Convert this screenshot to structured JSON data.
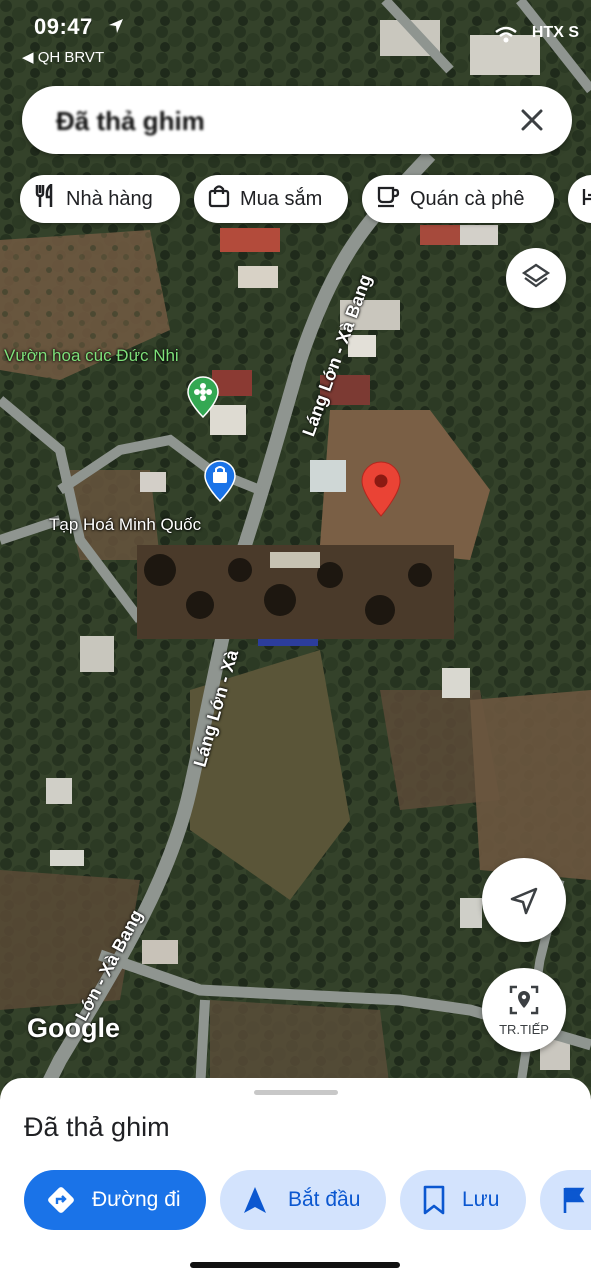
{
  "status_bar": {
    "time": "09:47",
    "back_label": "◀ QH BRVT",
    "carrier": "HTX S"
  },
  "search": {
    "query": "Đã thả ghim"
  },
  "chips": [
    {
      "label": "Nhà hàng",
      "icon": "fork-knife-icon"
    },
    {
      "label": "Mua sắm",
      "icon": "shopping-bag-icon"
    },
    {
      "label": "Quán cà phê",
      "icon": "coffee-cup-icon"
    }
  ],
  "map": {
    "places": [
      {
        "name": "Vườn hoa cúc Đức Nhi",
        "icon": "flower-pin-icon",
        "color": "#34a853"
      },
      {
        "name": "Tạp Hoá Minh Quốc",
        "icon": "shopping-pin-icon",
        "color": "#1a73e8"
      }
    ],
    "roads": [
      "Láng Lớn - Xà Bang",
      "Láng Lớn - Xà",
      "Lớn - Xà Bang"
    ],
    "attribution": "Google",
    "pin_color": "#ea4335"
  },
  "controls": {
    "layers_icon": "layers-icon",
    "locate_icon": "navigation-arrow-icon",
    "next_label": "TR.TIẾP"
  },
  "sheet": {
    "title": "Đã thả ghim",
    "actions": [
      {
        "label": "Đường đi",
        "icon": "directions-icon"
      },
      {
        "label": "Bắt đầu",
        "icon": "navigation-icon"
      },
      {
        "label": "Lưu",
        "icon": "bookmark-icon"
      }
    ]
  },
  "colors": {
    "primary": "#1a73e8",
    "primary_light": "#d3e3fd",
    "pin": "#ea4335"
  }
}
